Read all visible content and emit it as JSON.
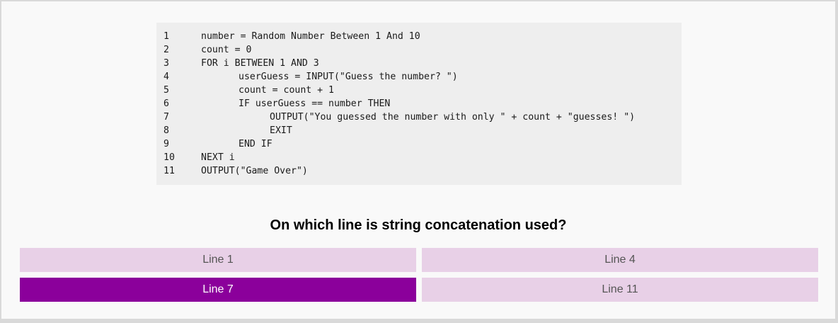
{
  "code": {
    "lines": [
      {
        "num": "1",
        "text": "number = Random Number Between 1 And 10"
      },
      {
        "num": "2",
        "text": "count = 0"
      },
      {
        "num": "3",
        "text": "FOR i BETWEEN 1 AND 3"
      },
      {
        "num": "4",
        "text": "userGuess = INPUT(\"Guess the number? \")"
      },
      {
        "num": "5",
        "text": "count = count + 1"
      },
      {
        "num": "6",
        "text": "IF userGuess == number THEN"
      },
      {
        "num": "7",
        "text": "OUTPUT(\"You guessed the number with only \" + count + \"guesses! \")"
      },
      {
        "num": "8",
        "text": "EXIT"
      },
      {
        "num": "9",
        "text": "END IF"
      },
      {
        "num": "10",
        "text": "NEXT i"
      },
      {
        "num": "11",
        "text": "OUTPUT(\"Game Over\")"
      }
    ]
  },
  "question": "On which line is string concatenation used?",
  "answers": [
    {
      "label": "Line 1"
    },
    {
      "label": "Line 4"
    },
    {
      "label": "Line 7"
    },
    {
      "label": "Line 11"
    }
  ],
  "selected_answer": "Line 7",
  "colors": {
    "answer_bg": "#e8d0e7",
    "selected_bg": "#8b009b",
    "code_bg": "#eeeeee"
  }
}
